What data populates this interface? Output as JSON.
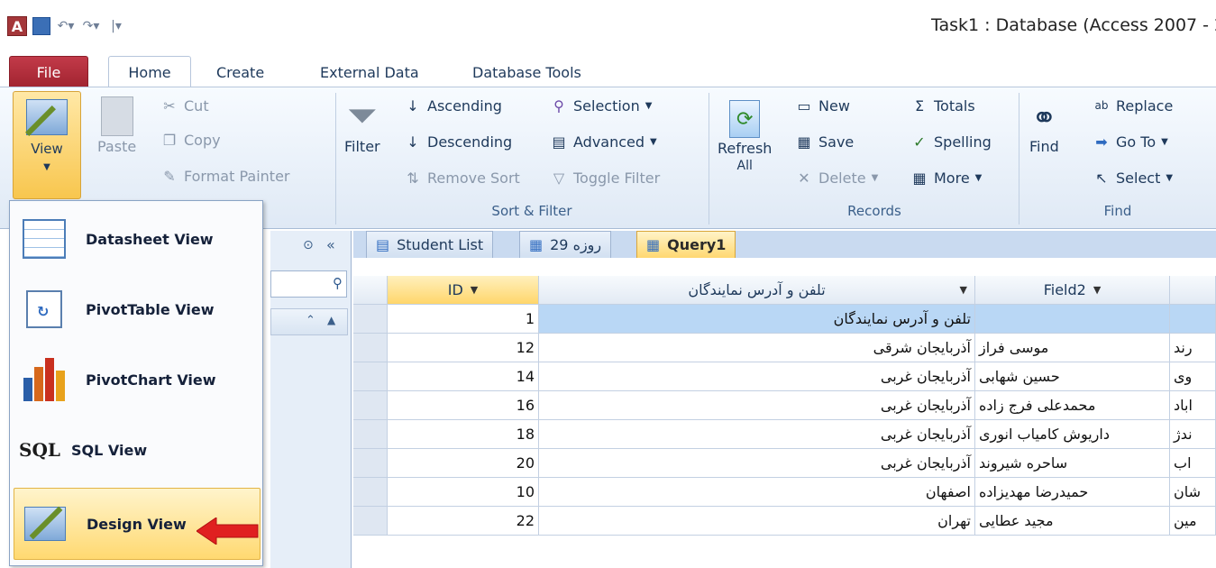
{
  "window": {
    "title": "Task1 : Database (Access 2007 - 2"
  },
  "ribbon_tabs": [
    "File",
    "Home",
    "Create",
    "External Data",
    "Database Tools"
  ],
  "clipboard": {
    "view": "View",
    "paste": "Paste",
    "cut": "Cut",
    "copy": "Copy",
    "format_painter": "Format Painter"
  },
  "sort_filter": {
    "label": "Sort & Filter",
    "filter": "Filter",
    "ascending": "Ascending",
    "descending": "Descending",
    "remove_sort": "Remove Sort",
    "selection": "Selection",
    "advanced": "Advanced",
    "toggle_filter": "Toggle Filter"
  },
  "records": {
    "label": "Records",
    "refresh": "Refresh",
    "refresh_sub": "All",
    "new": "New",
    "save": "Save",
    "delete": "Delete",
    "totals": "Totals",
    "spelling": "Spelling",
    "more": "More"
  },
  "find": {
    "label": "Find",
    "find": "Find",
    "replace": "Replace",
    "goto": "Go To",
    "select": "Select"
  },
  "view_menu": [
    {
      "label": "Datasheet View"
    },
    {
      "label": "PivotTable View"
    },
    {
      "label": "PivotChart View"
    },
    {
      "label": "SQL View",
      "prefix": "SQL"
    },
    {
      "label": "Design View"
    }
  ],
  "object_tabs": [
    "Student List",
    "روزه 29",
    "Query1"
  ],
  "datasheet": {
    "columns": [
      "ID",
      "تلفن و آدرس نمایندگان",
      "Field2"
    ],
    "rows": [
      {
        "id": "1",
        "f1": "تلفن و آدرس نمایندگان",
        "f2": "",
        "f3": ""
      },
      {
        "id": "12",
        "f1": "آذربایجان شرقی",
        "f2": "موسی فراز",
        "f3": "رند"
      },
      {
        "id": "14",
        "f1": "آذربایجان غربی",
        "f2": "حسین شهابی",
        "f3": "وی"
      },
      {
        "id": "16",
        "f1": "آذربایجان غربی",
        "f2": "محمدعلی فرج زاده",
        "f3": "اباد"
      },
      {
        "id": "18",
        "f1": "آذربایجان غربی",
        "f2": "داریوش کامیاب انوری",
        "f3": "ندژ"
      },
      {
        "id": "20",
        "f1": "آذربایجان غربی",
        "f2": "ساحره شیروند",
        "f3": "اب"
      },
      {
        "id": "10",
        "f1": "اصفهان",
        "f2": "حمیدرضا مهدیزاده",
        "f3": "شان"
      },
      {
        "id": "22",
        "f1": "تهران",
        "f2": "مجید عطایی",
        "f3": "مین"
      }
    ]
  }
}
